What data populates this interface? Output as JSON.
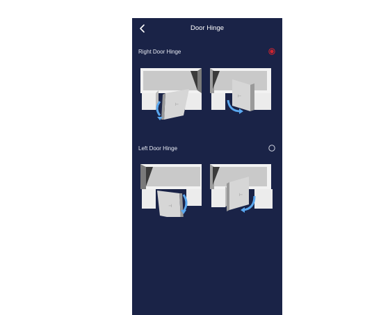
{
  "header": {
    "title": "Door Hinge",
    "back_icon": "chevron-left-icon"
  },
  "options": [
    {
      "label": "Right Door Hinge",
      "selected": true
    },
    {
      "label": "Left Door Hinge",
      "selected": false
    }
  ],
  "colors": {
    "background": "#1a2347",
    "selected_radio": "#d1242f",
    "arrow": "#5aa8f0"
  }
}
